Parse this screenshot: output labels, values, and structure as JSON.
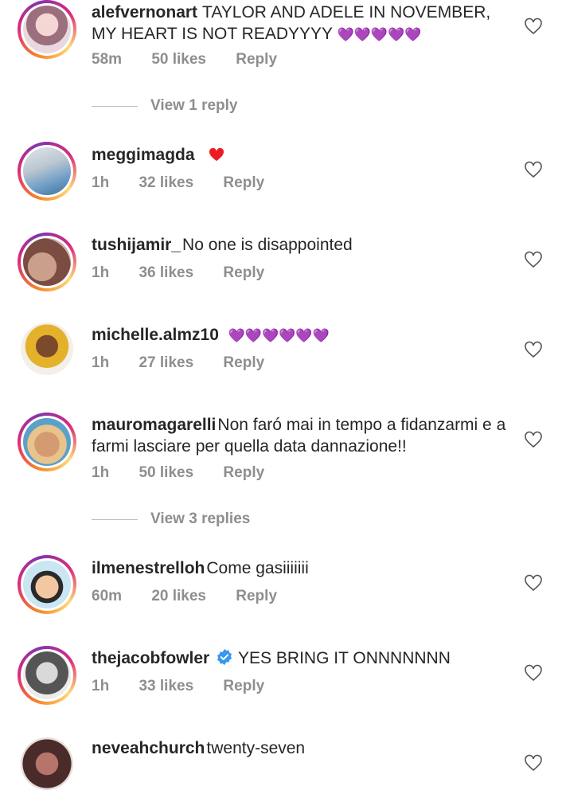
{
  "comments": [
    {
      "username": "alefvernonart",
      "text": "TAYLOR AND ADELE IN NOVEMBER, MY HEART IS NOT READYYYY",
      "emoji": "💜💜💜💜💜",
      "time": "58m",
      "likes": "50 likes",
      "reply": "Reply"
    },
    {
      "username": "meggimagda",
      "text": "",
      "emoji": "❤️",
      "time": "1h",
      "likes": "32 likes",
      "reply": "Reply"
    },
    {
      "username": "tushijamir_",
      "text": "No one is disappointed",
      "time": "1h",
      "likes": "36 likes",
      "reply": "Reply"
    },
    {
      "username": "michelle.almz10",
      "text": "",
      "emoji": "💜💜💜💜💜💜",
      "time": "1h",
      "likes": "27 likes",
      "reply": "Reply"
    },
    {
      "username": "mauromagarelli",
      "text": "Non faró mai in tempo a fidanzarmi e a farmi lasciare per quella data dannazione!!",
      "time": "1h",
      "likes": "50 likes",
      "reply": "Reply"
    },
    {
      "username": "ilmenestrelloh",
      "text": "Come gasiiiiiii",
      "time": "60m",
      "likes": "20 likes",
      "reply": "Reply"
    },
    {
      "username": "thejacobfowler",
      "text": "YES BRING IT ONNNNNNN",
      "time": "1h",
      "likes": "33 likes",
      "reply": "Reply"
    },
    {
      "username": "neveahchurch",
      "text": "twenty-seven"
    }
  ],
  "view_replies": [
    "View 1 reply",
    "View 3 replies"
  ],
  "colors": {
    "text": "#262626",
    "muted": "#8e8e8e",
    "heart_red": "#ed1c24",
    "purple_heart": "#c13ad6",
    "verified": "#3897f0"
  }
}
